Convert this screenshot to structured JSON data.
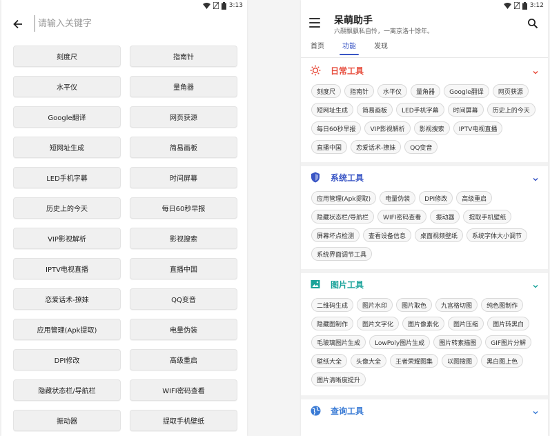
{
  "left_screen": {
    "status_time": "3:13",
    "search_placeholder": "请输入关键字",
    "tools": [
      "刻度尺",
      "指南针",
      "水平仪",
      "量角器",
      "Google翻译",
      "网页获源",
      "短网址生成",
      "简易画板",
      "LED手机字幕",
      "时间屏幕",
      "历史上的今天",
      "每日60秒早报",
      "VIP影视解析",
      "影视搜索",
      "IPTV电视直播",
      "直播中国",
      "恋爱话术-撩妹",
      "QQ变音",
      "应用管理(Apk提取)",
      "电量伪装",
      "DPI修改",
      "高级重启",
      "隐藏状态栏/导航栏",
      "WIFI密码查看",
      "振动器",
      "提取手机壁纸"
    ]
  },
  "right_screen": {
    "status_time": "3:12",
    "app_title": "呆萌助手",
    "app_subtitle": "六翮飘飖私自怜，一离京洛十馀年。",
    "tabs": [
      "首页",
      "功能",
      "发现"
    ],
    "active_tab": "功能",
    "sections": [
      {
        "title": "日常工具",
        "color": "#e74c3c",
        "icon": "sun-icon",
        "chips": [
          "刻度尺",
          "指南针",
          "水平仪",
          "量角器",
          "Google翻译",
          "网页获源",
          "短网址生成",
          "简易画板",
          "LED手机字幕",
          "时间屏幕",
          "历史上的今天",
          "每日60秒早报",
          "VIP影视解析",
          "影视搜索",
          "IPTV电视直播",
          "直播中国",
          "恋爱话术-撩妹",
          "QQ变音"
        ]
      },
      {
        "title": "系统工具",
        "color": "#3a56c5",
        "icon": "shield-icon",
        "chips": [
          "应用管理(Apk提取)",
          "电量伪装",
          "DPI修改",
          "高级重启",
          "隐藏状态栏/导航栏",
          "WIFI密码查看",
          "振动器",
          "提取手机壁纸",
          "屏幕坏点检测",
          "查看设备信息",
          "桌面视频壁纸",
          "系统字体大小调节",
          "系统界面调节工具"
        ]
      },
      {
        "title": "图片工具",
        "color": "#1aa39a",
        "icon": "image-icon",
        "chips": [
          "二维码生成",
          "图片水印",
          "图片取色",
          "九宫格切图",
          "纯色图制作",
          "隐藏图制作",
          "图片文字化",
          "图片像素化",
          "图片压缩",
          "图片转黑白",
          "毛玻璃图片生成",
          "LowPoly图片生成",
          "图片转素描图",
          "GIF图片分解",
          "壁纸大全",
          "头像大全",
          "王者荣耀图集",
          "以图搜图",
          "黑白图上色",
          "图片清晰度提升"
        ]
      },
      {
        "title": "查询工具",
        "color": "#3a7bd5",
        "icon": "globe-icon",
        "chips": []
      }
    ]
  }
}
